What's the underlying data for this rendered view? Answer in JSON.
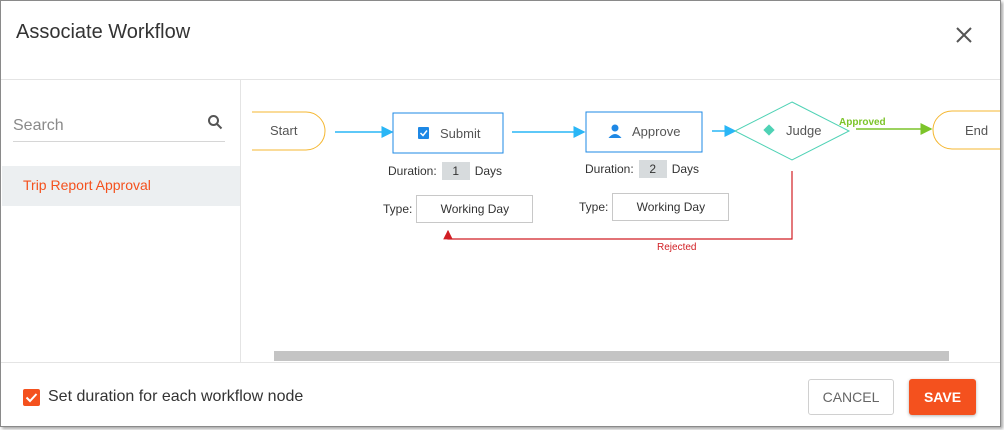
{
  "dialog": {
    "title": "Associate Workflow",
    "close_icon": "close-icon"
  },
  "sidebar": {
    "search": {
      "placeholder": "Search",
      "value": "",
      "icon": "search-icon"
    },
    "items": [
      {
        "label": "Trip Report Approval",
        "selected": true
      }
    ]
  },
  "workflow": {
    "nodes": {
      "start": "Start",
      "submit": "Submit",
      "approve": "Approve",
      "judge": "Judge",
      "end": "End"
    },
    "edges": {
      "approved": "Approved",
      "rejected": "Rejected"
    },
    "submit": {
      "duration_label": "Duration:",
      "duration": "1",
      "unit": "Days",
      "type_label": "Type:",
      "type": "Working Day"
    },
    "approve": {
      "duration_label": "Duration:",
      "duration": "2",
      "unit": "Days",
      "type_label": "Type:",
      "type": "Working Day"
    }
  },
  "footer": {
    "checkbox_label": "Set duration for each workflow node",
    "checked": true,
    "cancel_label": "CANCEL",
    "save_label": "SAVE"
  },
  "colors": {
    "accent": "#f4511e",
    "node_border": "#1e88e5",
    "terminal_border": "#f5b731",
    "decision_border": "#4fd2b5",
    "approved_line": "#7cc42a",
    "rejected_line": "#d11f24",
    "flow_arrow": "#29b6f6"
  }
}
